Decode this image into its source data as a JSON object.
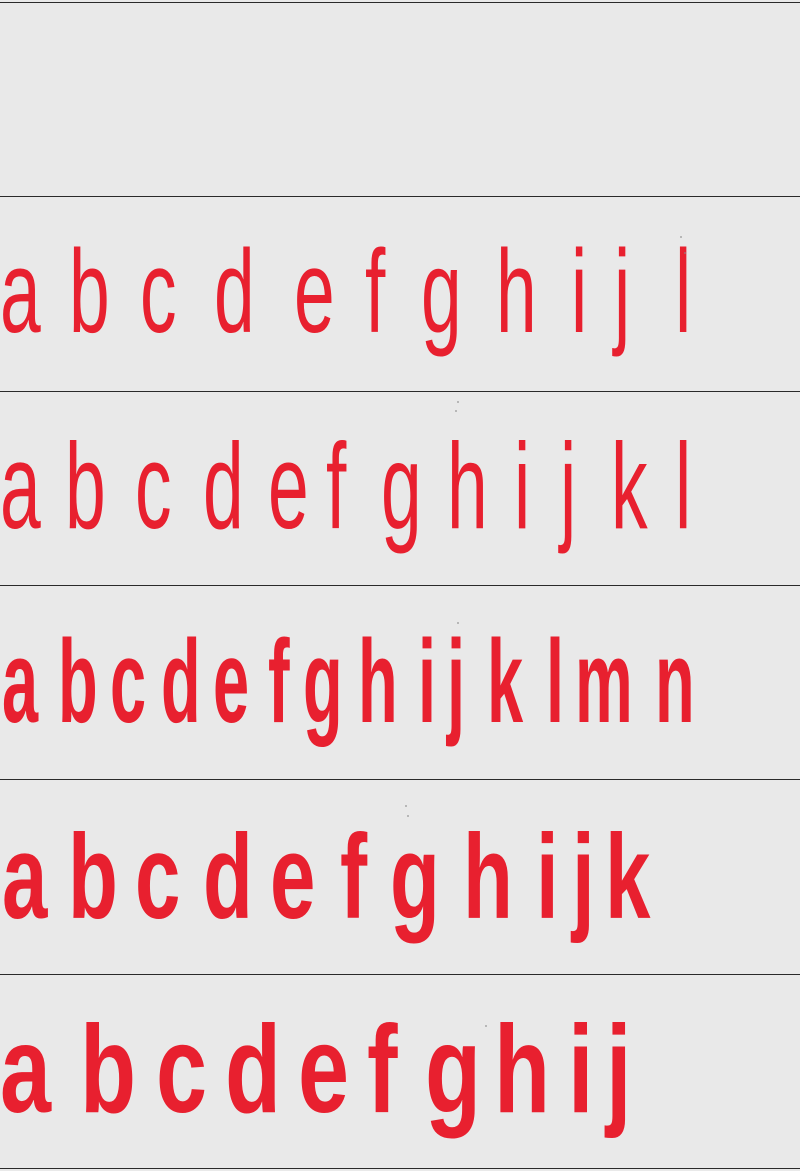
{
  "colors": {
    "background": "#e9e9e9",
    "ink": "#e8202f",
    "rule": "#2a2a2a"
  },
  "specimen_rows": [
    {
      "letters": "",
      "weight": "empty"
    },
    {
      "letters": "abcdefghijl",
      "weight": "thin"
    },
    {
      "letters": "abcdefghijkl",
      "weight": "light"
    },
    {
      "letters": "abcdefghijklmn",
      "weight": "regular"
    },
    {
      "letters": "abcdefghijk",
      "weight": "bold"
    },
    {
      "letters": "abcdefghij",
      "weight": "black"
    }
  ]
}
